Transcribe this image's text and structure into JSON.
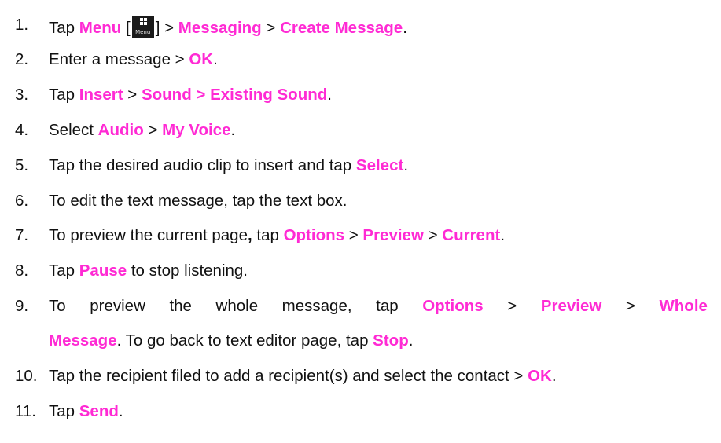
{
  "colors": {
    "highlight": "#ff2ad4",
    "text": "#111111"
  },
  "icons": {
    "menu": "menu-grid-icon"
  },
  "steps": [
    {
      "num": "1.",
      "t1": "Tap ",
      "h1": "Menu",
      "t2": " [",
      "icon_label": "Menu",
      "t3": "] > ",
      "h2": "Messaging",
      "t4": " > ",
      "h3": "Create Message",
      "t5": "."
    },
    {
      "num": "2.",
      "t1": "Enter a message > ",
      "h1": "OK",
      "t2": "."
    },
    {
      "num": "3.",
      "t1": "Tap ",
      "h1": "Insert",
      "t2": " > ",
      "h2": "Sound > Existing Sound",
      "t3": "."
    },
    {
      "num": "4.",
      "t1": "Select ",
      "h1": "Audio",
      "t2": " > ",
      "h2": "My Voice",
      "t3": "."
    },
    {
      "num": "5.",
      "t1": "Tap the desired audio clip to insert and tap ",
      "h1": "Select",
      "t2": "."
    },
    {
      "num": "6.",
      "t1": "To edit the text message, tap the text box."
    },
    {
      "num": "7.",
      "t1": "To preview the current page",
      "b1": ",",
      "t2": " tap ",
      "h1": "Options",
      "t3": " > ",
      "h2": "Preview",
      "t4": " > ",
      "h3": "Current",
      "t5": "."
    },
    {
      "num": "8.",
      "t1": "Tap ",
      "h1": "Pause",
      "t2": " to stop listening."
    },
    {
      "num": "9.",
      "line1": {
        "w1": "To",
        "w2": "preview",
        "w3": "the",
        "w4": "whole",
        "w5": "message,",
        "w6": "tap",
        "h1": "Options",
        "w7": ">",
        "h2": "Preview",
        "w8": ">",
        "h3": "Whole"
      },
      "line2": {
        "h1": "Message",
        "t1": ". To go back to text editor page, tap ",
        "h2": "Stop",
        "t2": "."
      }
    },
    {
      "num": "10.",
      "t1": "Tap the recipient filed to add a recipient(s) and select the contact > ",
      "h1": "OK",
      "t2": "."
    },
    {
      "num": "11.",
      "t1": "Tap ",
      "h1": "Send",
      "t2": "."
    }
  ]
}
